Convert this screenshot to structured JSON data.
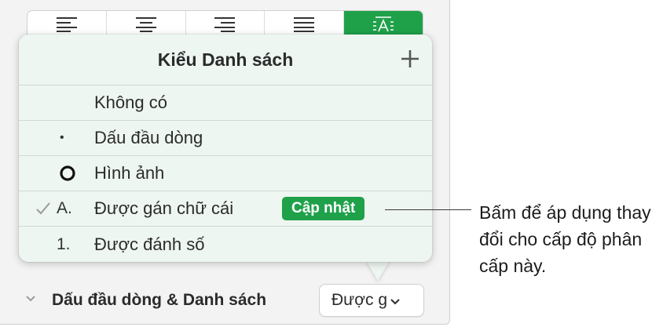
{
  "toolbar": {
    "alignment_buttons": [
      {
        "icon": "align-left-icon"
      },
      {
        "icon": "align-center-icon"
      },
      {
        "icon": "align-right-icon"
      },
      {
        "icon": "justify-icon"
      },
      {
        "icon": "text-auto-fit-icon",
        "selected": true
      }
    ]
  },
  "popover": {
    "title": "Kiểu Danh sách",
    "add_icon": "plus-icon",
    "items": [
      {
        "marker": "",
        "label": "Không có",
        "checked": false
      },
      {
        "marker": "•",
        "label": "Dấu đầu dòng",
        "checked": false
      },
      {
        "marker": "image-bullet-ring",
        "label": "Hình ảnh",
        "checked": false
      },
      {
        "marker": "A.",
        "label": "Được gán chữ cái",
        "checked": true,
        "action_label": "Cập nhật"
      },
      {
        "marker": "1.",
        "label": "Được đánh số",
        "checked": false
      }
    ]
  },
  "section": {
    "label": "Dấu đầu dòng & Danh sách",
    "popup_value": "Được g"
  },
  "callout": {
    "text": "Bấm để áp dụng thay đổi cho cấp độ phân cấp này."
  },
  "colors": {
    "accent": "#1fa14a",
    "popover_bg": "#eef6f1",
    "panel_bg": "#f3f3f3"
  }
}
